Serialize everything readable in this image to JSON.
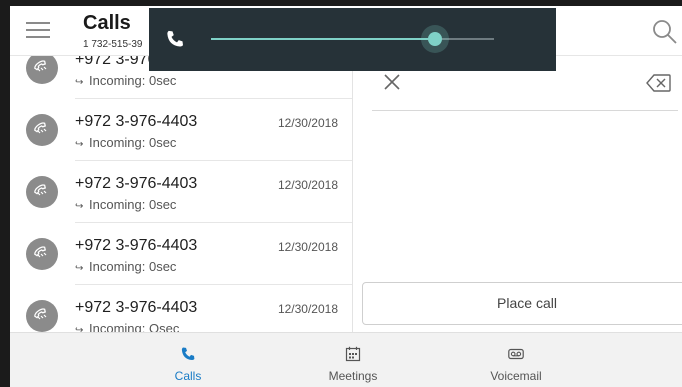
{
  "header": {
    "title": "Calls",
    "line_number": "1 732-515-39"
  },
  "calls": [
    {
      "number": "+972 3-976",
      "status": "Incoming: 0sec",
      "date": ""
    },
    {
      "number": "+972 3-976-4403",
      "status": "Incoming: 0sec",
      "date": "12/30/2018"
    },
    {
      "number": "+972 3-976-4403",
      "status": "Incoming: 0sec",
      "date": "12/30/2018"
    },
    {
      "number": "+972 3-976-4403",
      "status": "Incoming: 0sec",
      "date": "12/30/2018"
    },
    {
      "number": "+972 3-976-4403",
      "status": "Incoming: Osec",
      "date": "12/30/2018"
    }
  ],
  "dialer": {
    "place_call_label": "Place call"
  },
  "nav": {
    "calls": "Calls",
    "meetings": "Meetings",
    "voicemail": "Voicemail"
  },
  "volume": {
    "level": 0.79
  },
  "icons": {
    "menu": "hamburger-icon",
    "search": "search-icon",
    "clear": "close-icon",
    "backspace": "backspace-icon",
    "avatar": "phone-handset-icon",
    "status": "incoming-call-icon",
    "calls_tab": "phone-icon",
    "meetings_tab": "calendar-icon",
    "voicemail_tab": "voicemail-icon",
    "volume": "phone-icon"
  },
  "colors": {
    "accent": "#1a7cc6",
    "overlay": "#263238",
    "slider": "#7fd1c7"
  }
}
